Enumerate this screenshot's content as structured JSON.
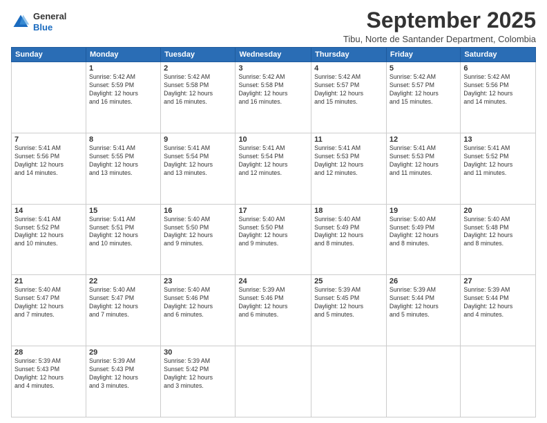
{
  "header": {
    "logo": {
      "line1": "General",
      "line2": "Blue"
    },
    "title": "September 2025",
    "location": "Tibu, Norte de Santander Department, Colombia"
  },
  "weekdays": [
    "Sunday",
    "Monday",
    "Tuesday",
    "Wednesday",
    "Thursday",
    "Friday",
    "Saturday"
  ],
  "weeks": [
    [
      {
        "day": "",
        "info": ""
      },
      {
        "day": "1",
        "info": "Sunrise: 5:42 AM\nSunset: 5:59 PM\nDaylight: 12 hours\nand 16 minutes."
      },
      {
        "day": "2",
        "info": "Sunrise: 5:42 AM\nSunset: 5:58 PM\nDaylight: 12 hours\nand 16 minutes."
      },
      {
        "day": "3",
        "info": "Sunrise: 5:42 AM\nSunset: 5:58 PM\nDaylight: 12 hours\nand 16 minutes."
      },
      {
        "day": "4",
        "info": "Sunrise: 5:42 AM\nSunset: 5:57 PM\nDaylight: 12 hours\nand 15 minutes."
      },
      {
        "day": "5",
        "info": "Sunrise: 5:42 AM\nSunset: 5:57 PM\nDaylight: 12 hours\nand 15 minutes."
      },
      {
        "day": "6",
        "info": "Sunrise: 5:42 AM\nSunset: 5:56 PM\nDaylight: 12 hours\nand 14 minutes."
      }
    ],
    [
      {
        "day": "7",
        "info": "Sunrise: 5:41 AM\nSunset: 5:56 PM\nDaylight: 12 hours\nand 14 minutes."
      },
      {
        "day": "8",
        "info": "Sunrise: 5:41 AM\nSunset: 5:55 PM\nDaylight: 12 hours\nand 13 minutes."
      },
      {
        "day": "9",
        "info": "Sunrise: 5:41 AM\nSunset: 5:54 PM\nDaylight: 12 hours\nand 13 minutes."
      },
      {
        "day": "10",
        "info": "Sunrise: 5:41 AM\nSunset: 5:54 PM\nDaylight: 12 hours\nand 12 minutes."
      },
      {
        "day": "11",
        "info": "Sunrise: 5:41 AM\nSunset: 5:53 PM\nDaylight: 12 hours\nand 12 minutes."
      },
      {
        "day": "12",
        "info": "Sunrise: 5:41 AM\nSunset: 5:53 PM\nDaylight: 12 hours\nand 11 minutes."
      },
      {
        "day": "13",
        "info": "Sunrise: 5:41 AM\nSunset: 5:52 PM\nDaylight: 12 hours\nand 11 minutes."
      }
    ],
    [
      {
        "day": "14",
        "info": "Sunrise: 5:41 AM\nSunset: 5:52 PM\nDaylight: 12 hours\nand 10 minutes."
      },
      {
        "day": "15",
        "info": "Sunrise: 5:41 AM\nSunset: 5:51 PM\nDaylight: 12 hours\nand 10 minutes."
      },
      {
        "day": "16",
        "info": "Sunrise: 5:40 AM\nSunset: 5:50 PM\nDaylight: 12 hours\nand 9 minutes."
      },
      {
        "day": "17",
        "info": "Sunrise: 5:40 AM\nSunset: 5:50 PM\nDaylight: 12 hours\nand 9 minutes."
      },
      {
        "day": "18",
        "info": "Sunrise: 5:40 AM\nSunset: 5:49 PM\nDaylight: 12 hours\nand 8 minutes."
      },
      {
        "day": "19",
        "info": "Sunrise: 5:40 AM\nSunset: 5:49 PM\nDaylight: 12 hours\nand 8 minutes."
      },
      {
        "day": "20",
        "info": "Sunrise: 5:40 AM\nSunset: 5:48 PM\nDaylight: 12 hours\nand 8 minutes."
      }
    ],
    [
      {
        "day": "21",
        "info": "Sunrise: 5:40 AM\nSunset: 5:47 PM\nDaylight: 12 hours\nand 7 minutes."
      },
      {
        "day": "22",
        "info": "Sunrise: 5:40 AM\nSunset: 5:47 PM\nDaylight: 12 hours\nand 7 minutes."
      },
      {
        "day": "23",
        "info": "Sunrise: 5:40 AM\nSunset: 5:46 PM\nDaylight: 12 hours\nand 6 minutes."
      },
      {
        "day": "24",
        "info": "Sunrise: 5:39 AM\nSunset: 5:46 PM\nDaylight: 12 hours\nand 6 minutes."
      },
      {
        "day": "25",
        "info": "Sunrise: 5:39 AM\nSunset: 5:45 PM\nDaylight: 12 hours\nand 5 minutes."
      },
      {
        "day": "26",
        "info": "Sunrise: 5:39 AM\nSunset: 5:44 PM\nDaylight: 12 hours\nand 5 minutes."
      },
      {
        "day": "27",
        "info": "Sunrise: 5:39 AM\nSunset: 5:44 PM\nDaylight: 12 hours\nand 4 minutes."
      }
    ],
    [
      {
        "day": "28",
        "info": "Sunrise: 5:39 AM\nSunset: 5:43 PM\nDaylight: 12 hours\nand 4 minutes."
      },
      {
        "day": "29",
        "info": "Sunrise: 5:39 AM\nSunset: 5:43 PM\nDaylight: 12 hours\nand 3 minutes."
      },
      {
        "day": "30",
        "info": "Sunrise: 5:39 AM\nSunset: 5:42 PM\nDaylight: 12 hours\nand 3 minutes."
      },
      {
        "day": "",
        "info": ""
      },
      {
        "day": "",
        "info": ""
      },
      {
        "day": "",
        "info": ""
      },
      {
        "day": "",
        "info": ""
      }
    ]
  ]
}
